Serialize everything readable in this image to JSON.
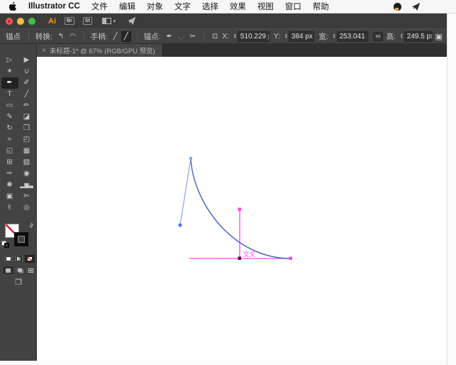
{
  "menu_bar": {
    "app_name": "Illustrator CC",
    "items": [
      "文件",
      "编辑",
      "对象",
      "文字",
      "选择",
      "效果",
      "视图",
      "窗口",
      "帮助"
    ]
  },
  "title_bar": {
    "ai_logo": "Ai",
    "bridge_button": "Br",
    "stock_button": "St",
    "workspace_chevron": "▾"
  },
  "control_bar": {
    "panel_label": "锚点",
    "convert_label": "转换:",
    "convert_corner_glyph": "↰",
    "convert_smooth_glyph": "◠",
    "handles_label": "手柄:",
    "handle_show_glyph": "╱",
    "handle_hide_glyph": "╱",
    "anchors_label": "锚点:",
    "remove_anchor_glyph": "✒",
    "connect_glyph": "◡",
    "cut_path_glyph": "✂",
    "reference_point_glyph": "⊡",
    "stepper_up_glyph": "▴",
    "stepper_down_glyph": "▾",
    "x_label": "X:",
    "x_value": "510.229 p",
    "y_label": "Y:",
    "y_value": "384 px",
    "width_label": "宽:",
    "width_value": "253.041 p",
    "link_glyph": "∞",
    "height_label": "高:",
    "height_value": "249.5 px",
    "transform_glyph": "▣"
  },
  "document_tab": {
    "close_glyph": "×",
    "title": "未标题-1* @ 67% (RGB/GPU 预览)"
  },
  "tools": {
    "left": [
      {
        "name": "direct-selection-tool",
        "glyph": "▷"
      },
      {
        "name": "magic-wand-tool",
        "glyph": "✶"
      },
      {
        "name": "pen-tool",
        "glyph": "✒",
        "selected": true
      },
      {
        "name": "type-tool",
        "glyph": "T"
      },
      {
        "name": "rectangle-tool",
        "glyph": "▭"
      },
      {
        "name": "shaper-tool",
        "glyph": "✎"
      },
      {
        "name": "rotate-tool",
        "glyph": "↻"
      },
      {
        "name": "width-tool",
        "glyph": "≈"
      },
      {
        "name": "shape-builder-tool",
        "glyph": "◱"
      },
      {
        "name": "perspective-grid-tool",
        "glyph": "⊞"
      },
      {
        "name": "eyedropper-tool",
        "glyph": "✑"
      },
      {
        "name": "symbol-sprayer-tool",
        "glyph": "✺"
      },
      {
        "name": "artboard-tool",
        "glyph": "▣"
      },
      {
        "name": "hand-tool",
        "glyph": "✌"
      }
    ],
    "right": [
      {
        "name": "selection-tool",
        "glyph": "▶"
      },
      {
        "name": "lasso-tool",
        "glyph": "∪"
      },
      {
        "name": "curvature-tool",
        "glyph": "✐"
      },
      {
        "name": "line-segment-tool",
        "glyph": "╱"
      },
      {
        "name": "paintbrush-tool",
        "glyph": "✏"
      },
      {
        "name": "eraser-tool",
        "glyph": "◪"
      },
      {
        "name": "free-transform-tool",
        "glyph": "❐"
      },
      {
        "name": "perspective-selection-tool",
        "glyph": "◰"
      },
      {
        "name": "mesh-tool",
        "glyph": "▦"
      },
      {
        "name": "gradient-tool",
        "glyph": "▨"
      },
      {
        "name": "blend-tool",
        "glyph": "◉"
      },
      {
        "name": "column-graph-tool",
        "glyph": "▂▆▃"
      },
      {
        "name": "slice-tool",
        "glyph": "✄"
      },
      {
        "name": "zoom-tool",
        "glyph": "◎"
      }
    ]
  },
  "tools_bottom": {
    "swap_glyph": "⇄",
    "screen_mode_glyph": "❐"
  },
  "canvas": {
    "guide_label": "交叉",
    "curve_color": "#4061c8",
    "handle_color": "#8aa4f0",
    "handle_dot_color": "#4d79f2",
    "guide_color": "#f843f8",
    "intersection_color": "#470c47"
  }
}
